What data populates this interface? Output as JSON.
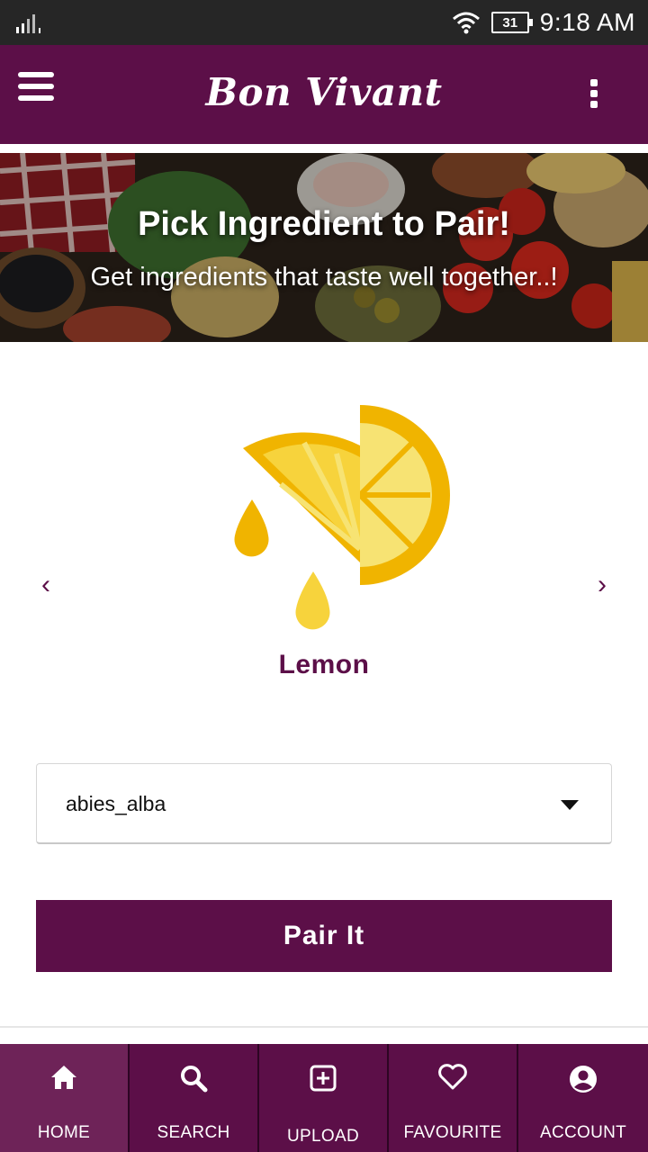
{
  "status_bar": {
    "battery": "31",
    "time": "9:18 AM"
  },
  "app_bar": {
    "title": "Bon Vivant",
    "menu_icon": "hamburger-menu-icon",
    "overflow_icon": "more-vert-icon"
  },
  "banner": {
    "title": "Pick Ingredient to Pair!",
    "subtitle": "Get ingredients that taste well together..!"
  },
  "carousel": {
    "ingredient_name": "Lemon",
    "prev_icon": "chevron-left-icon",
    "next_icon": "chevron-right-icon",
    "prev_glyph": "‹",
    "next_glyph": "›"
  },
  "pairing_select": {
    "selected": "abies_alba"
  },
  "pair_button": {
    "label": "Pair It"
  },
  "bottom_nav": {
    "items": [
      {
        "label": "HOME",
        "icon": "home-icon",
        "active": true
      },
      {
        "label": "SEARCH",
        "icon": "search-icon",
        "active": false
      },
      {
        "label": "UPLOAD",
        "icon": "add-box-icon",
        "active": false
      },
      {
        "label": "FAVOURITE",
        "icon": "heart-icon",
        "active": false
      },
      {
        "label": "ACCOUNT",
        "icon": "account-circle-icon",
        "active": false
      }
    ]
  },
  "colors": {
    "brand": "#5c0f48",
    "nav_active": "#6e2358",
    "status_bar": "#262626",
    "lemon_yellow": "#f0b400"
  }
}
